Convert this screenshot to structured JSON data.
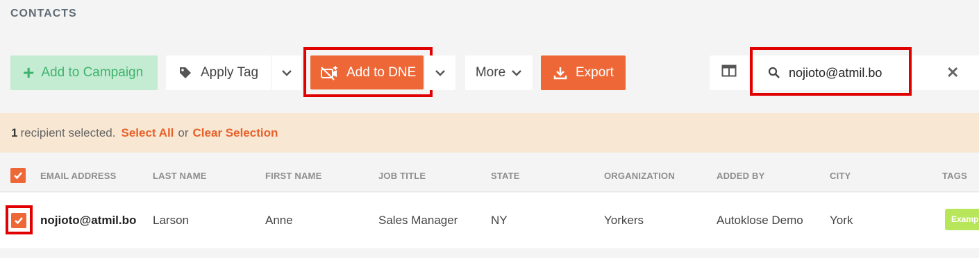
{
  "page": {
    "title": "CONTACTS"
  },
  "toolbar": {
    "add_campaign": {
      "plus": "+",
      "label": "Add to Campaign"
    },
    "apply_tag": {
      "label": "Apply Tag"
    },
    "add_dne": {
      "label": "Add to DNE"
    },
    "more": {
      "label": "More"
    },
    "export": {
      "label": "Export"
    }
  },
  "search": {
    "value": "nojioto@atmil.bo",
    "placeholder": "",
    "clear": "✕"
  },
  "selection": {
    "count": "1",
    "text": "recipient selected.",
    "select_all": "Select All",
    "or": "or",
    "clear": "Clear Selection"
  },
  "table": {
    "columns": [
      "EMAIL ADDRESS",
      "LAST NAME",
      "FIRST NAME",
      "JOB TITLE",
      "STATE",
      "ORGANIZATION",
      "ADDED BY",
      "CITY",
      "TAGS"
    ],
    "rows": [
      {
        "email": "nojioto@atmil.bo",
        "last_name": "Larson",
        "first_name": "Anne",
        "job_title": "Sales Manager",
        "state": "NY",
        "organization": "Yorkers",
        "added_by": "Autoklose Demo",
        "city": "York",
        "tag": "Examp"
      }
    ]
  },
  "colors": {
    "accent": "#ee6837",
    "campaign_bg": "#c3ecd3",
    "campaign_fg": "#3fb26b",
    "banner": "#f8e7d2",
    "highlight": "#e00000"
  }
}
